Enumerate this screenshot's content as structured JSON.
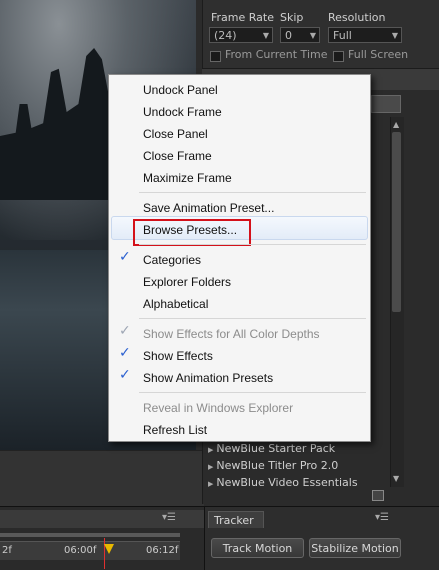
{
  "preview": {
    "frame_rate_label": "Frame Rate",
    "skip_label": "Skip",
    "resolution_label": "Resolution",
    "frame_rate_value": "(24)",
    "skip_value": "0",
    "resolution_value": "Full",
    "from_current_time_label": "From Current Time",
    "full_screen_label": "Full Screen"
  },
  "context_menu": {
    "items": [
      {
        "label": "Undock Panel",
        "enabled": true,
        "checked": false
      },
      {
        "label": "Undock Frame",
        "enabled": true,
        "checked": false
      },
      {
        "label": "Close Panel",
        "enabled": true,
        "checked": false
      },
      {
        "label": "Close Frame",
        "enabled": true,
        "checked": false
      },
      {
        "label": "Maximize Frame",
        "enabled": true,
        "checked": false
      },
      {
        "label": "Save Animation Preset...",
        "enabled": true,
        "checked": false
      },
      {
        "label": "Browse Presets...",
        "enabled": true,
        "checked": false,
        "highlighted": true
      },
      {
        "label": "Categories",
        "enabled": true,
        "checked": true
      },
      {
        "label": "Explorer Folders",
        "enabled": true,
        "checked": false
      },
      {
        "label": "Alphabetical",
        "enabled": true,
        "checked": false
      },
      {
        "label": "Show Effects for All Color Depths",
        "enabled": false,
        "checked": true
      },
      {
        "label": "Show Effects",
        "enabled": true,
        "checked": true
      },
      {
        "label": "Show Animation Presets",
        "enabled": true,
        "checked": true
      },
      {
        "label": "Reveal in Windows Explorer",
        "enabled": false,
        "checked": false
      },
      {
        "label": "Refresh List",
        "enabled": true,
        "checked": false
      }
    ],
    "check_glyph": "✓"
  },
  "effects_panel": {
    "items": [
      "NewBlue Starter Pack",
      "NewBlue Titler Pro 2.0",
      "NewBlue Video Essentials"
    ],
    "expand_glyph": "▶"
  },
  "timeline": {
    "ticks": [
      "2f",
      "06:00f",
      "06:12f"
    ],
    "menu_glyph": "▾☰"
  },
  "tracker": {
    "tab_label": "Tracker",
    "track_motion_label": "Track Motion",
    "stabilize_motion_label": "Stabilize Motion",
    "menu_glyph": "▾☰"
  },
  "colors": {
    "highlight_border": "#d4111a",
    "check_color": "#2a5fd0",
    "menu_background": "#f5f5f5",
    "cti_color": "#e8b800"
  }
}
